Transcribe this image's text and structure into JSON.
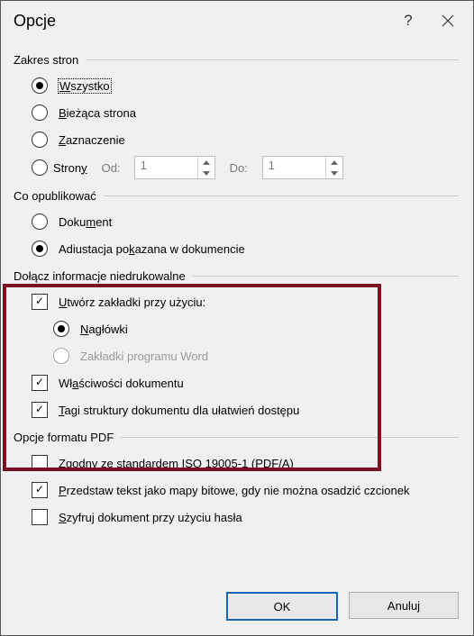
{
  "window": {
    "title": "Opcje"
  },
  "groups": {
    "range": {
      "legend": "Zakres stron",
      "options": {
        "all": {
          "pre": "",
          "m": "W",
          "post": "szystko"
        },
        "page": {
          "pre": "",
          "m": "B",
          "post": "ieżąca strona"
        },
        "sel": {
          "pre": "",
          "m": "Z",
          "post": "aznaczenie"
        },
        "pages": {
          "pre": "Stron",
          "m": "y",
          "post": ""
        }
      },
      "from_label": "Od:",
      "from_value": "1",
      "to_label": "Do:",
      "to_value": "1"
    },
    "publish": {
      "legend": "Co opublikować",
      "doc": {
        "pre": "Doku",
        "m": "m",
        "post": "ent"
      },
      "adj": {
        "pre": "Adiustacja po",
        "m": "k",
        "post": "azana w dokumencie"
      }
    },
    "nonprint": {
      "legend": "Dołącz informacje niedrukowalne",
      "bookmarks": {
        "pre": "",
        "m": "U",
        "post": "twórz zakładki przy użyciu:"
      },
      "headings": {
        "pre": "",
        "m": "N",
        "post": "agłówki"
      },
      "wordbm": {
        "text": "Zakładki programu Word"
      },
      "props": {
        "pre": "Wł",
        "m": "a",
        "post": "ściwości dokumentu"
      },
      "tags": {
        "pre": "",
        "m": "T",
        "post": "agi struktury dokumentu dla ułatwień dostępu"
      }
    },
    "pdf": {
      "legend": "Opcje formatu PDF",
      "iso": {
        "pre": "Zgodny ze standardem ISO ",
        "m": "1",
        "post": "9005-1 (PDF/A)"
      },
      "bmp": {
        "pre": "",
        "m": "P",
        "post": "rzedstaw tekst jako mapy bitowe, gdy nie można osadzić czcionek"
      },
      "enc": {
        "pre": "",
        "m": "S",
        "post": "zyfruj dokument przy użyciu hasła"
      }
    }
  },
  "buttons": {
    "ok": "OK",
    "cancel": "Anuluj"
  }
}
